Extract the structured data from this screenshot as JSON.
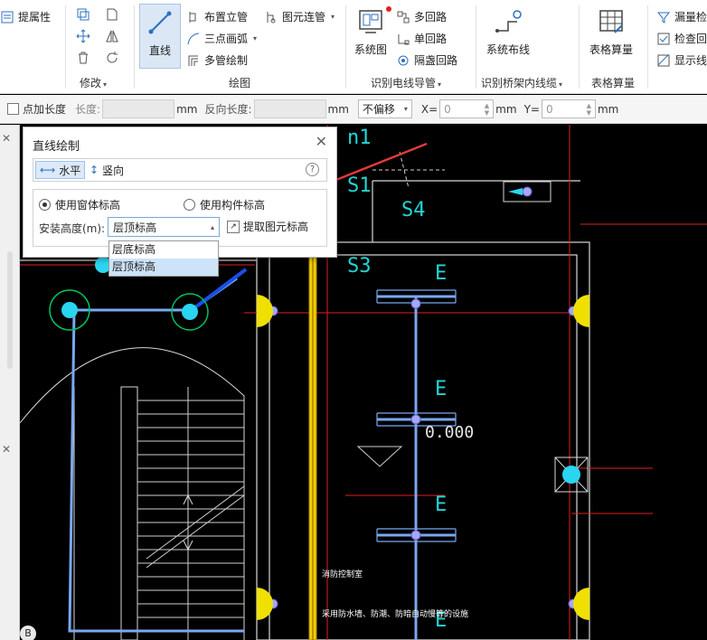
{
  "ribbon": {
    "props_label": "提属性",
    "modify_group": "修改",
    "draw_group": "绘图",
    "line_button": "直线",
    "place_riser": "布置立管",
    "three_point_arc": "三点画弧",
    "multi_pipe_draw": "多管绘制",
    "element_connect_pipe": "图元连管",
    "system_diagram": "系统图",
    "multi_circuit": "多回路",
    "single_circuit": "单回路",
    "cover_circuit": "隔盏回路",
    "identify_wire_group": "识别电线导管",
    "system_wiring": "系统布线",
    "identify_tray_group": "识别桥架内线缆",
    "table_calc": "表格算量",
    "table_calc_group": "表格算量",
    "missing_check": "漏量检",
    "check_circuit": "检查回",
    "show_line": "显示线"
  },
  "optbar": {
    "add_length_label": "点加长度",
    "length_label": "长度:",
    "unit_mm": "mm",
    "reverse_length_label": "反向长度:",
    "offset_value": "不偏移",
    "x_label": "X=",
    "x_value": "0",
    "y_label": "Y=",
    "y_value": "0"
  },
  "dialog": {
    "title": "直线绘制",
    "horizontal": "水平",
    "vertical": "竖向",
    "help": "?",
    "use_window_height": "使用窗体标高",
    "use_component_height": "使用构件标高",
    "install_height_label": "安装高度(m):",
    "install_height_value": "层顶标高",
    "pick_height": "提取图元标高",
    "dropdown_options": [
      "层底标高",
      "层顶标高"
    ]
  },
  "cad": {
    "labels": [
      "n1",
      "S1",
      "S4",
      "S3",
      "E",
      "E",
      "E",
      "E",
      "0.000"
    ],
    "note1": "消防控制室",
    "note2": "采用防水墙、防潮、防暗自动慢等的设施",
    "corner_label": "B"
  },
  "colors": {
    "accent": "#2d6fc0",
    "cad_cyan": "#22d6d6",
    "cad_red": "#e02020",
    "cad_yellow": "#f0d000",
    "arrow_red": "#e23a3a"
  }
}
